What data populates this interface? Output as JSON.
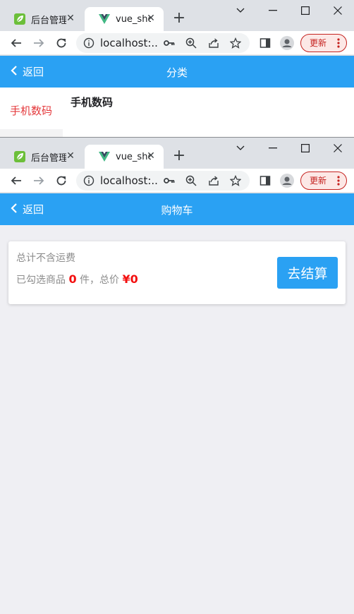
{
  "windows": [
    {
      "tabs": {
        "inactive_title": "后台管理",
        "active_title": "vue_shop"
      },
      "address": {
        "url": "localhost:..."
      },
      "update_label": "更新",
      "nav": {
        "back_label": "返回",
        "title": "分类"
      },
      "category": {
        "left_item": "手机数码",
        "right_title": "手机数码"
      }
    },
    {
      "tabs": {
        "inactive_title": "后台管理",
        "active_title": "vue_shop"
      },
      "address": {
        "url": "localhost:..."
      },
      "update_label": "更新",
      "nav": {
        "back_label": "返回",
        "title": "购物车"
      },
      "cart": {
        "shipping_note": "总计不含运费",
        "selected_prefix": "已勾选商品",
        "selected_count": "0",
        "selected_unit": "件，总价",
        "total": "¥0",
        "checkout_label": "去结算"
      }
    }
  ],
  "colors": {
    "nav_blue": "#2aa1f3",
    "price_red": "#f30f0f",
    "category_red": "#e4393c"
  }
}
